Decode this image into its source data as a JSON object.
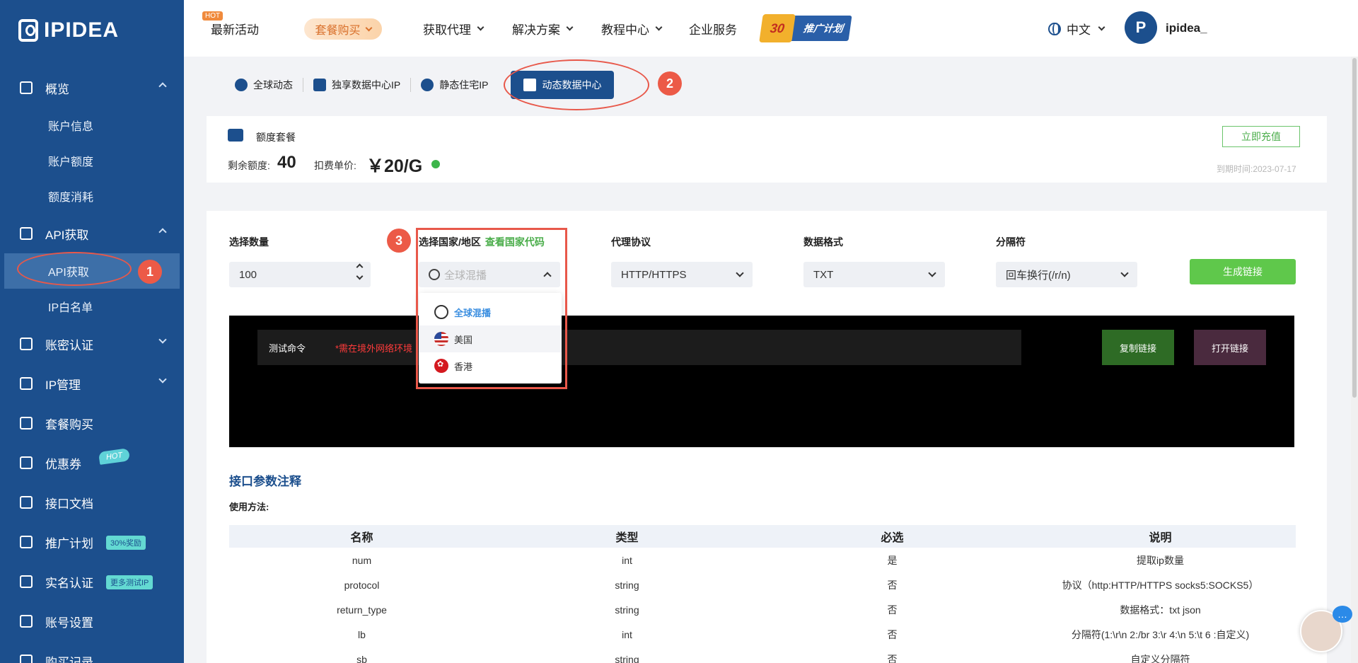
{
  "brand": {
    "name": "IPIDEA"
  },
  "sidebar": {
    "items": [
      {
        "label": "概览",
        "icon": "overview-icon",
        "caret": "up",
        "children": [
          {
            "label": "账户信息"
          },
          {
            "label": "账户额度"
          },
          {
            "label": "额度消耗"
          }
        ]
      },
      {
        "label": "API获取",
        "icon": "api-icon",
        "caret": "up",
        "children": [
          {
            "label": "API获取",
            "active": true
          },
          {
            "label": "IP白名单"
          }
        ]
      },
      {
        "label": "账密认证",
        "icon": "account-auth-icon",
        "caret": "down"
      },
      {
        "label": "IP管理",
        "icon": "ip-manage-icon",
        "caret": "down"
      },
      {
        "label": "套餐购买",
        "icon": "cart-icon"
      },
      {
        "label": "优惠券",
        "icon": "coupon-icon",
        "badge": "HOT"
      },
      {
        "label": "接口文档",
        "icon": "doc-icon"
      },
      {
        "label": "推广计划",
        "icon": "promo-icon",
        "badge": "30%奖励"
      },
      {
        "label": "实名认证",
        "icon": "id-card-icon",
        "badge": "更多测试IP"
      },
      {
        "label": "账号设置",
        "icon": "user-icon"
      },
      {
        "label": "购买记录",
        "icon": "cart-icon"
      }
    ]
  },
  "topbar": {
    "hot_tag": "HOT",
    "latest": "最新活动",
    "buy": "套餐购买",
    "nav": [
      "获取代理",
      "解决方案",
      "教程中心",
      "企业服务"
    ],
    "promo_number": "30",
    "promo_label": "推广计划",
    "language": "中文",
    "username": "ipidea_"
  },
  "tabs": [
    {
      "label": "全球动态",
      "icon": "globe-icon"
    },
    {
      "label": "独享数据中心IP",
      "icon": "server-icon"
    },
    {
      "label": "静态住宅IP",
      "icon": "location-icon"
    },
    {
      "label": "动态数据中心",
      "icon": "layers-icon",
      "active": true
    }
  ],
  "balance": {
    "plan_label": "额度套餐",
    "remaining_label": "剩余额度:",
    "remaining_value": "40",
    "unit_price_label": "扣费单价:",
    "unit_price_value": "￥20/G",
    "recharge_button": "立即充值",
    "expiry": "到期时间:2023-07-17"
  },
  "form": {
    "quantity_label": "选择数量",
    "quantity_value": "100",
    "country_label": "选择国家/地区",
    "country_code_link": "查看国家代码",
    "country_placeholder": "全球混播",
    "protocol_label": "代理协议",
    "protocol_value": "HTTP/HTTPS",
    "format_label": "数据格式",
    "format_value": "TXT",
    "separator_label": "分隔符",
    "separator_value": "回车换行(/r/n)",
    "generate_button": "生成链接"
  },
  "dropdown": {
    "options": [
      {
        "label": "全球混播",
        "flag": "globe",
        "selected": true
      },
      {
        "label": "美国",
        "flag": "us"
      },
      {
        "label": "香港",
        "flag": "hk"
      }
    ]
  },
  "command": {
    "label": "测试命令",
    "warning": "*需在境外网络环境",
    "copy_button": "复制链接",
    "open_button": "打开链接"
  },
  "params": {
    "title": "接口参数注释",
    "usage_label": "使用方法:",
    "headers": [
      "名称",
      "类型",
      "必选",
      "说明"
    ],
    "rows": [
      [
        "num",
        "int",
        "是",
        "提取ip数量"
      ],
      [
        "protocol",
        "string",
        "否",
        "协议（http:HTTP/HTTPS socks5:SOCKS5）"
      ],
      [
        "return_type",
        "string",
        "否",
        "数据格式：txt json"
      ],
      [
        "lb",
        "int",
        "否",
        "分隔符(1:\\r\\n 2:/br 3:\\r 4:\\n 5:\\t 6 :自定义)"
      ],
      [
        "sb",
        "string",
        "否",
        "自定义分隔符"
      ]
    ]
  },
  "annotations": [
    "1",
    "2",
    "3"
  ],
  "colors": {
    "sidebar": "#1c4f8d",
    "accent_green": "#5fc84b",
    "annotation_red": "#e8584a"
  }
}
